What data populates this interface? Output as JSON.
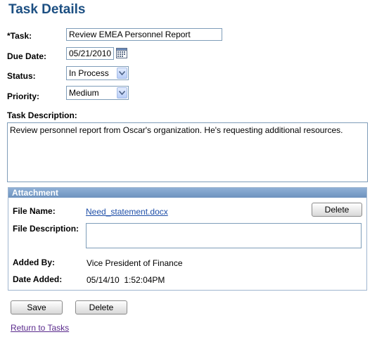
{
  "page": {
    "title": "Task Details"
  },
  "form": {
    "task_label": "*Task:",
    "task_value": "Review EMEA Personnel Report",
    "due_label": "Due Date:",
    "due_value": "05/21/2010",
    "status_label": "Status:",
    "status_value": "In Process",
    "priority_label": "Priority:",
    "priority_value": "Medium",
    "desc_label": "Task Description:",
    "desc_value": "Review personnel report from Oscar's organization. He's requesting additional resources."
  },
  "attachment": {
    "header": "Attachment",
    "file_name_label": "File Name:",
    "file_name_value": "Need_statement.docx",
    "delete_label": "Delete",
    "file_desc_label": "File Description:",
    "file_desc_value": "",
    "added_by_label": "Added By:",
    "added_by_value": "Vice President of Finance",
    "date_added_label": "Date Added:",
    "date_added_value": "05/14/10  1:52:04PM"
  },
  "actions": {
    "save_label": "Save",
    "delete_label": "Delete",
    "return_link": "Return to Tasks"
  }
}
